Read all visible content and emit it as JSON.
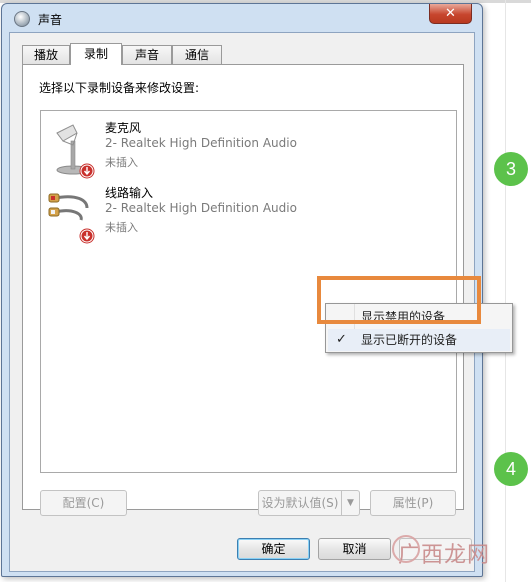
{
  "window": {
    "title": "声音",
    "close_label": "✕"
  },
  "tabs": [
    {
      "label": "播放",
      "active": false
    },
    {
      "label": "录制",
      "active": true
    },
    {
      "label": "声音",
      "active": false
    },
    {
      "label": "通信",
      "active": false
    }
  ],
  "instruction": "选择以下录制设备来修改设置:",
  "devices": [
    {
      "name": "麦克风",
      "description": "2- Realtek High Definition Audio",
      "status": "未插入",
      "icon": "microphone-icon"
    },
    {
      "name": "线路输入",
      "description": "2- Realtek High Definition Audio",
      "status": "未插入",
      "icon": "line-in-cable-icon"
    }
  ],
  "context_menu": {
    "items": [
      {
        "label": "显示禁用的设备",
        "checked": false
      },
      {
        "label": "显示已断开的设备",
        "checked": true
      }
    ],
    "check_mark": "✓"
  },
  "buttons": {
    "configure": "配置(C)",
    "set_default": "设为默认值(S)",
    "properties": "属性(P)",
    "ok": "确定",
    "cancel": "取消"
  },
  "steps": [
    "3",
    "4"
  ],
  "watermark": "广西龙网",
  "colors": {
    "highlight": "#e8893d",
    "step_circle": "#5cc24b",
    "disconnected_badge": "#c9302c"
  }
}
